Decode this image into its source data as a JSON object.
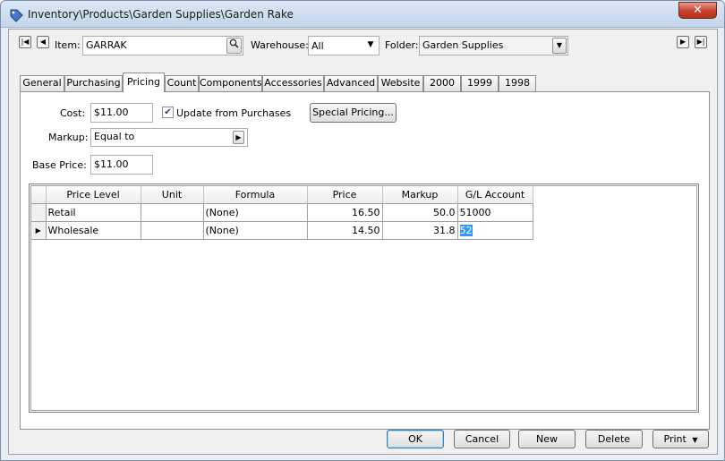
{
  "window": {
    "title": "Inventory\\Products\\Garden Supplies\\Garden Rake",
    "close_glyph": "✕"
  },
  "header": {
    "item_label": "Item:",
    "item_value": "GARRAK",
    "warehouse_label": "Warehouse:",
    "warehouse_value": "All",
    "folder_label": "Folder:",
    "folder_value": "Garden Supplies"
  },
  "tabs": [
    {
      "label": "General"
    },
    {
      "label": "Purchasing"
    },
    {
      "label": "Pricing"
    },
    {
      "label": "Count"
    },
    {
      "label": "Components"
    },
    {
      "label": "Accessories"
    },
    {
      "label": "Advanced"
    },
    {
      "label": "Website"
    },
    {
      "label": "2000"
    },
    {
      "label": "1999"
    },
    {
      "label": "1998"
    }
  ],
  "active_tab": "Pricing",
  "pricing": {
    "cost_label": "Cost:",
    "cost_value": "$11.00",
    "update_label": "Update from Purchases",
    "update_checked": true,
    "special_pricing_label": "Special Pricing...",
    "markup_label": "Markup:",
    "markup_value": "Equal to",
    "base_price_label": "Base Price:",
    "base_price_value": "$11.00"
  },
  "grid": {
    "columns": [
      "Price Level",
      "Unit",
      "Formula",
      "Price",
      "Markup",
      "G/L Account"
    ],
    "rows": [
      {
        "price_level": "Retail",
        "unit": "",
        "formula": "(None)",
        "price": "16.50",
        "markup": "50.0",
        "gl_account": "51000"
      },
      {
        "price_level": "Wholesale",
        "unit": "",
        "formula": "(None)",
        "price": "14.50",
        "markup": "31.8",
        "gl_account": "52"
      }
    ]
  },
  "buttons": {
    "ok": "OK",
    "cancel": "Cancel",
    "new": "New",
    "delete": "Delete",
    "print": "Print"
  },
  "colors": {
    "title_bar": "#c4d6ec",
    "close_button": "#c8402c",
    "selection": "#3399ff"
  }
}
